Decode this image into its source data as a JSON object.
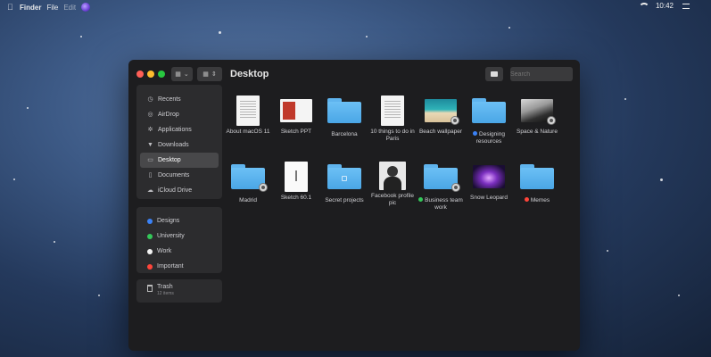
{
  "menubar": {
    "apple_icon": "apple-icon",
    "items": [
      "Finder",
      "File",
      "Edit"
    ],
    "time": "10:42"
  },
  "window": {
    "title": "Desktop",
    "search_placeholder": "Search"
  },
  "sidebar": {
    "favorites": [
      {
        "label": "Recents",
        "icon": "clock-icon"
      },
      {
        "label": "AirDrop",
        "icon": "airdrop-icon"
      },
      {
        "label": "Applications",
        "icon": "applications-icon"
      },
      {
        "label": "Downloads",
        "icon": "download-icon"
      },
      {
        "label": "Desktop",
        "icon": "desktop-icon",
        "active": true
      },
      {
        "label": "Documents",
        "icon": "document-icon"
      },
      {
        "label": "iCloud Drive",
        "icon": "cloud-icon"
      }
    ],
    "tags": [
      {
        "label": "Designs",
        "color": "#3b82f6"
      },
      {
        "label": "University",
        "color": "#34c759"
      },
      {
        "label": "Work",
        "color": "#f2f2f2"
      },
      {
        "label": "Important",
        "color": "#ff453a"
      }
    ],
    "trash": {
      "label": "Trash",
      "sub": "12 items"
    }
  },
  "files": [
    {
      "name": "About macOS 11",
      "kind": "doc"
    },
    {
      "name": "Sketch PPT",
      "kind": "ppt"
    },
    {
      "name": "Barcelona",
      "kind": "folder"
    },
    {
      "name": "10 things to do in Paris",
      "kind": "doc"
    },
    {
      "name": "Beach wallpaper",
      "kind": "beach",
      "shared": true
    },
    {
      "name": "Designing resources",
      "kind": "folder",
      "tag": "#3b82f6"
    },
    {
      "name": "Space & Nature",
      "kind": "space",
      "shared": true
    },
    {
      "name": "Madrid",
      "kind": "folder",
      "shared": true
    },
    {
      "name": "Sketch 60.1",
      "kind": "sketch"
    },
    {
      "name": "Secret projects",
      "kind": "folder-lock"
    },
    {
      "name": "Facebook profile pic",
      "kind": "photo"
    },
    {
      "name": "Business team work",
      "kind": "folder",
      "shared": true,
      "tag": "#34c759"
    },
    {
      "name": "Snow Leopard",
      "kind": "galaxy"
    },
    {
      "name": "Memes",
      "kind": "folder",
      "tag": "#ff453a"
    }
  ]
}
